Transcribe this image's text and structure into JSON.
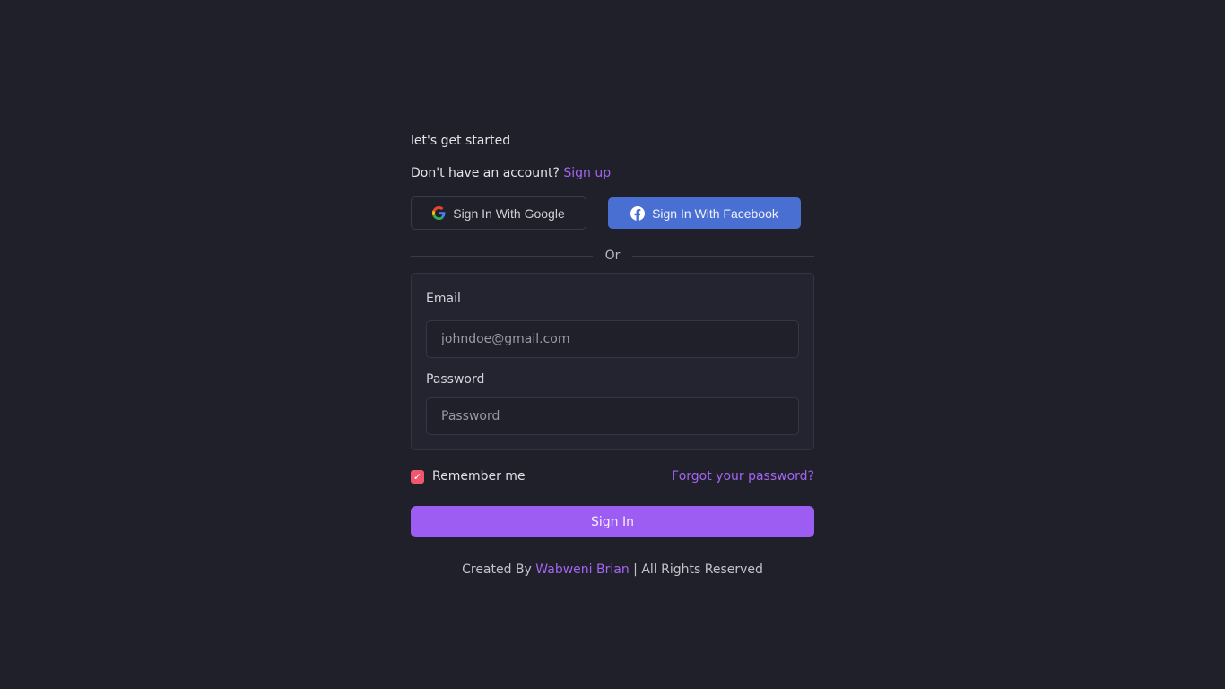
{
  "header": {
    "tagline": "let's get started",
    "signup_prompt": "Don't have an account?",
    "signup_link": "Sign up"
  },
  "social": {
    "google_label": "Sign In With Google",
    "google_icon": "google-icon",
    "facebook_label": "Sign In With Facebook",
    "facebook_icon": "facebook-icon",
    "facebook_color": "#4a6fd3"
  },
  "divider": {
    "label": "Or"
  },
  "form": {
    "email_label": "Email",
    "email_placeholder": "johndoe@gmail.com",
    "email_value": "",
    "password_label": "Password",
    "password_placeholder": "Password",
    "password_value": ""
  },
  "options": {
    "remember_label": "Remember me",
    "remember_checked": true,
    "checkbox_color": "#f0566d",
    "forgot_link": "Forgot your password?"
  },
  "submit": {
    "label": "Sign In",
    "color": "#9d5cf2"
  },
  "footer": {
    "prefix": "Created By",
    "author": "Wabweni Brian",
    "suffix": "| All Rights Reserved"
  },
  "theme": {
    "background": "#1f2029",
    "accent": "#a565f0"
  }
}
